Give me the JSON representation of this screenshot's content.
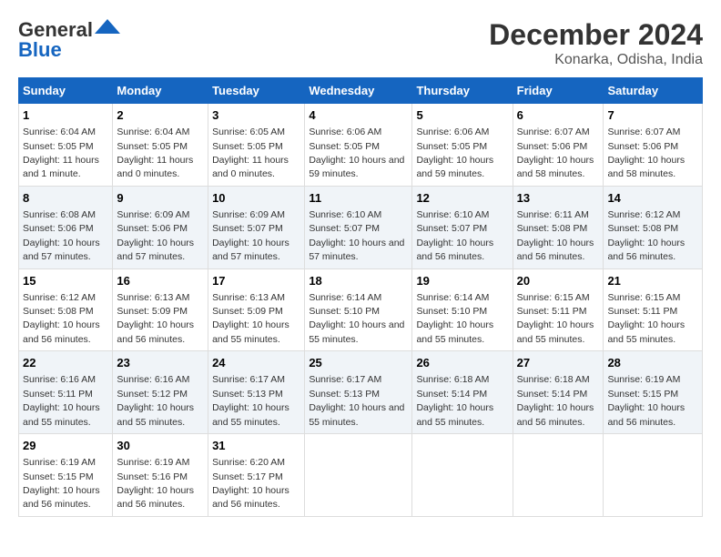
{
  "header": {
    "logo_line1": "General",
    "logo_line2": "Blue",
    "title": "December 2024",
    "subtitle": "Konarka, Odisha, India"
  },
  "weekdays": [
    "Sunday",
    "Monday",
    "Tuesday",
    "Wednesday",
    "Thursday",
    "Friday",
    "Saturday"
  ],
  "weeks": [
    [
      {
        "day": "1",
        "rise": "6:04 AM",
        "set": "5:05 PM",
        "dh": "11 hours and 1 minute."
      },
      {
        "day": "2",
        "rise": "6:04 AM",
        "set": "5:05 PM",
        "dh": "11 hours and 0 minutes."
      },
      {
        "day": "3",
        "rise": "6:05 AM",
        "set": "5:05 PM",
        "dh": "11 hours and 0 minutes."
      },
      {
        "day": "4",
        "rise": "6:06 AM",
        "set": "5:05 PM",
        "dh": "10 hours and 59 minutes."
      },
      {
        "day": "5",
        "rise": "6:06 AM",
        "set": "5:05 PM",
        "dh": "10 hours and 59 minutes."
      },
      {
        "day": "6",
        "rise": "6:07 AM",
        "set": "5:06 PM",
        "dh": "10 hours and 58 minutes."
      },
      {
        "day": "7",
        "rise": "6:07 AM",
        "set": "5:06 PM",
        "dh": "10 hours and 58 minutes."
      }
    ],
    [
      {
        "day": "8",
        "rise": "6:08 AM",
        "set": "5:06 PM",
        "dh": "10 hours and 57 minutes."
      },
      {
        "day": "9",
        "rise": "6:09 AM",
        "set": "5:06 PM",
        "dh": "10 hours and 57 minutes."
      },
      {
        "day": "10",
        "rise": "6:09 AM",
        "set": "5:07 PM",
        "dh": "10 hours and 57 minutes."
      },
      {
        "day": "11",
        "rise": "6:10 AM",
        "set": "5:07 PM",
        "dh": "10 hours and 57 minutes."
      },
      {
        "day": "12",
        "rise": "6:10 AM",
        "set": "5:07 PM",
        "dh": "10 hours and 56 minutes."
      },
      {
        "day": "13",
        "rise": "6:11 AM",
        "set": "5:08 PM",
        "dh": "10 hours and 56 minutes."
      },
      {
        "day": "14",
        "rise": "6:12 AM",
        "set": "5:08 PM",
        "dh": "10 hours and 56 minutes."
      }
    ],
    [
      {
        "day": "15",
        "rise": "6:12 AM",
        "set": "5:08 PM",
        "dh": "10 hours and 56 minutes."
      },
      {
        "day": "16",
        "rise": "6:13 AM",
        "set": "5:09 PM",
        "dh": "10 hours and 56 minutes."
      },
      {
        "day": "17",
        "rise": "6:13 AM",
        "set": "5:09 PM",
        "dh": "10 hours and 55 minutes."
      },
      {
        "day": "18",
        "rise": "6:14 AM",
        "set": "5:10 PM",
        "dh": "10 hours and 55 minutes."
      },
      {
        "day": "19",
        "rise": "6:14 AM",
        "set": "5:10 PM",
        "dh": "10 hours and 55 minutes."
      },
      {
        "day": "20",
        "rise": "6:15 AM",
        "set": "5:11 PM",
        "dh": "10 hours and 55 minutes."
      },
      {
        "day": "21",
        "rise": "6:15 AM",
        "set": "5:11 PM",
        "dh": "10 hours and 55 minutes."
      }
    ],
    [
      {
        "day": "22",
        "rise": "6:16 AM",
        "set": "5:11 PM",
        "dh": "10 hours and 55 minutes."
      },
      {
        "day": "23",
        "rise": "6:16 AM",
        "set": "5:12 PM",
        "dh": "10 hours and 55 minutes."
      },
      {
        "day": "24",
        "rise": "6:17 AM",
        "set": "5:13 PM",
        "dh": "10 hours and 55 minutes."
      },
      {
        "day": "25",
        "rise": "6:17 AM",
        "set": "5:13 PM",
        "dh": "10 hours and 55 minutes."
      },
      {
        "day": "26",
        "rise": "6:18 AM",
        "set": "5:14 PM",
        "dh": "10 hours and 55 minutes."
      },
      {
        "day": "27",
        "rise": "6:18 AM",
        "set": "5:14 PM",
        "dh": "10 hours and 56 minutes."
      },
      {
        "day": "28",
        "rise": "6:19 AM",
        "set": "5:15 PM",
        "dh": "10 hours and 56 minutes."
      }
    ],
    [
      {
        "day": "29",
        "rise": "6:19 AM",
        "set": "5:15 PM",
        "dh": "10 hours and 56 minutes."
      },
      {
        "day": "30",
        "rise": "6:19 AM",
        "set": "5:16 PM",
        "dh": "10 hours and 56 minutes."
      },
      {
        "day": "31",
        "rise": "6:20 AM",
        "set": "5:17 PM",
        "dh": "10 hours and 56 minutes."
      },
      null,
      null,
      null,
      null
    ]
  ],
  "labels": {
    "sunrise": "Sunrise:",
    "sunset": "Sunset:",
    "daylight": "Daylight:"
  }
}
